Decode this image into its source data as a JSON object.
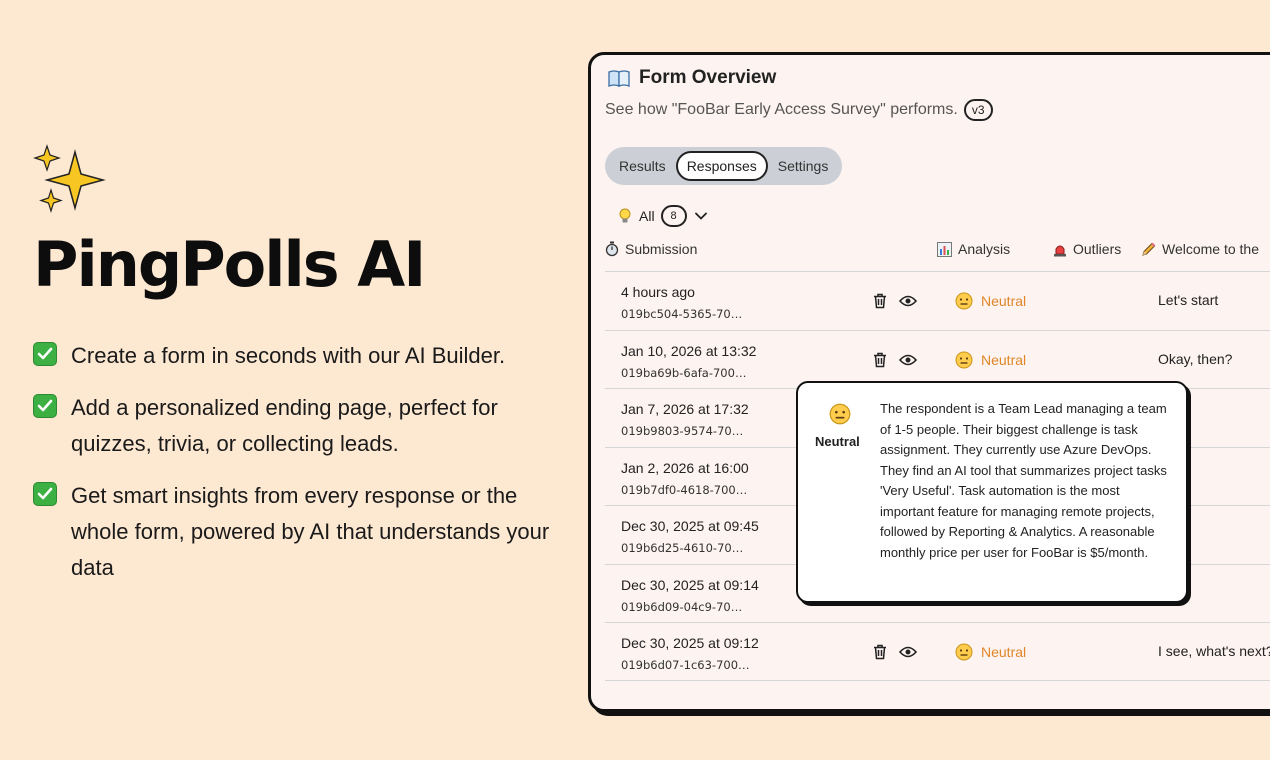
{
  "brand": "PingPolls AI",
  "features": [
    "Create a form in seconds with our AI Builder.",
    "Add a personalized ending page, perfect for quizzes, trivia, or collecting leads.",
    "Get smart insights from every response or the whole form, powered by AI that understands your data"
  ],
  "window": {
    "title": "Form Overview",
    "subtitle": "See how \"FooBar Early Access Survey\" performs.",
    "version": "v3",
    "tabs": [
      "Results",
      "Responses",
      "Settings"
    ],
    "active_tab": "Responses",
    "filter": {
      "label": "All",
      "count": "8"
    },
    "columns": {
      "submission": "Submission",
      "analysis": "Analysis",
      "outliers": "Outliers",
      "welcome": "Welcome to the"
    },
    "rows": [
      {
        "time": "4 hours ago",
        "id": "019bc504-5365-70…",
        "analysis": "Neutral",
        "welcome": "Let's start"
      },
      {
        "time": "Jan 10, 2026 at 13:32",
        "id": "019ba69b-6afa-700…",
        "analysis": "Neutral",
        "welcome": "Okay, then?"
      },
      {
        "time": "Jan 7, 2026 at 17:32",
        "id": "019b9803-9574-70…",
        "analysis": "",
        "welcome": ""
      },
      {
        "time": "Jan 2, 2026 at 16:00",
        "id": "019b7df0-4618-700…",
        "analysis": "",
        "welcome": ""
      },
      {
        "time": "Dec 30, 2025 at 09:45",
        "id": "019b6d25-4610-70…",
        "analysis": "",
        "welcome": ""
      },
      {
        "time": "Dec 30, 2025 at 09:14",
        "id": "019b6d09-04c9-70…",
        "analysis": "",
        "welcome": ""
      },
      {
        "time": "Dec 30, 2025 at 09:12",
        "id": "019b6d07-1c63-700…",
        "analysis": "Neutral",
        "welcome": "I see, what's next?"
      }
    ]
  },
  "tooltip": {
    "label": "Neutral",
    "text": "The respondent is a Team Lead managing a team of 1-5 people. Their biggest challenge is task assignment. They currently use Azure DevOps. They find an AI tool that summarizes project tasks 'Very Useful'. Task automation is the most important feature for managing remote projects, followed by Reporting & Analytics. A reasonable monthly price per user for FooBar is $5/month."
  },
  "colors": {
    "background": "#fde8d2",
    "neutral_accent": "#e0862a",
    "check_green": "#3cb043",
    "window_bg": "#fdf3f0"
  }
}
